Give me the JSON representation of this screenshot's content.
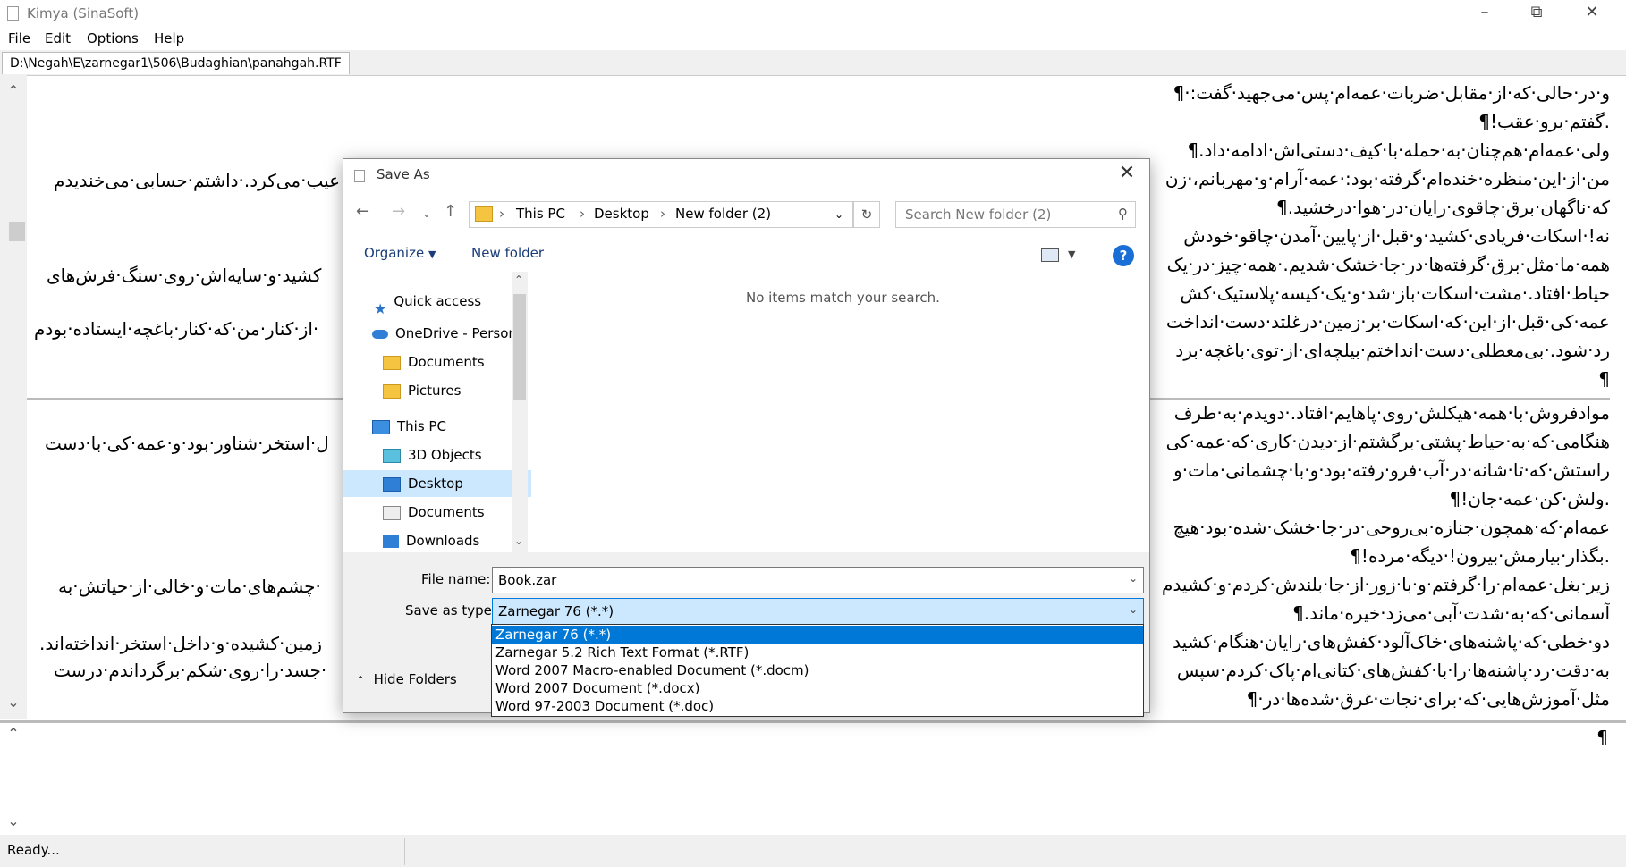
{
  "window": {
    "title": "Kimya (SinaSoft)"
  },
  "menu": [
    "File",
    "Edit",
    "Options",
    "Help"
  ],
  "tab": {
    "path": "D:\\Negah\\E\\zarnegar1\\506\\Budaghian\\panahgah.RTF"
  },
  "editor": {
    "lines": [
      "و·در·حالی·که·از·مقابل·ضربات·عمه‌ام·پس·می‌جهید·گفت:·¶",
      ".گفتم·برو·عقب!¶",
      "ولی·عمه‌ام·هم‌چنان·به·حمله·با·کیف·دستی‌اش·ادامه·داد.¶",
      "من·از·این·منظره·خنده‌ام·گرفته·بود:·عمه·آرام·و·مهربانم،·زن",
      "که·ناگهان·برق·چاقوی·رایان·در·هوا·درخشید.¶",
      "نه!·اسکات·فریادی·کشید·و·قبل·از·پایین·آمدن·چاقو·خودش",
      "همه·ما·مثل·برق·گرفته‌ها·در·جا·خشک·شدیم.·همه·چیز·در·یک",
      "حیاط·افتاد.·مشت·اسکات·باز·شد·و·یک·کیسه·پلاستیک·کش",
      "عمه·کی·قبل·از·این·که·اسکات·بر·زمین·درغلتد·دست·انداخت",
      "رد·شود.·بی‌معطلی·دست·انداختم·بیلچه‌ای·از·توی·باغچه·برد",
      "¶",
      "موادفروش·با·همه·هیکلش·روی·پاهایم·افتاد.·دویدم·به·طرف",
      "هنگامی·که·به·حیاط·پشتی·برگشتم·از·دیدن·کاری·که·عمه·کی",
      "راستش·که·تا·شانه·در·آب·فرو·رفته·بود·و·با·چشمانی·مات·و",
      ".ولش·کن·عمه·جان!¶",
      "عمه‌ام·که·همچون·جنازه·بی‌روحی·در·جا·خشک·شده·بود·هیچ",
      ".بگذار·بیارمش·بیرون!·دیگه·مرده!¶",
      "زیر·بغل·عمه‌ام·را·گرفتم·و·با·زور·از·جا·بلندش·کردم·و·کشیدم",
      "آسمانی·که·به·شدت·آبی·می‌زد·خیره·ماند.¶",
      "دو·خطی·که·پاشنه‌های·خاک‌آلود·کفش‌های·رایان·هنگام·کشید",
      "به·دقت·رد·پاشنه‌ها·را·با·کفش‌های·کتانی‌ام·پاک·کردم·سپس",
      "مثل·آموزش‌هایی·که·برای·نجات·غرق·شده‌ها·در·¶"
    ],
    "left_fragments": [
      "عیب·می‌کرد.·داشتم·حسابی·می‌خندیدم",
      "کشید·و·سایه‌اش·روی·سنگ·فرش‌های",
      "·از·کنار·من·که·کنار·باغچه·ایستاده·بودم",
      "ل·استخر·شناور·بود·و·عمه·کی·با·دست",
      "·چشم‌های·مات·و·خالی·از·حیاتش·به",
      "زمین·کشیده·و·داخل·استخر·انداخته‌اند.",
      "·جسد·را·روی·شکم·برگرداندم·درست"
    ],
    "lower_pane": "¶"
  },
  "status": {
    "text": "Ready..."
  },
  "dialog": {
    "title": "Save As",
    "breadcrumbs": [
      "This PC",
      "Desktop",
      "New folder (2)"
    ],
    "search_placeholder": "Search New folder (2)",
    "organize": "Organize",
    "new_folder": "New folder",
    "nav_items": [
      "Quick access",
      "OneDrive - Person",
      "Documents",
      "Pictures",
      "This PC",
      "3D Objects",
      "Desktop",
      "Documents",
      "Downloads"
    ],
    "empty_message": "No items match your search.",
    "file_name_label": "File name:",
    "file_name_value": "Book.zar",
    "save_type_label": "Save as type:",
    "save_type_value": "Zarnegar 76 (*.*)",
    "hide_folders": "Hide Folders",
    "type_options": [
      "Zarnegar 76 (*.*)",
      "Zarnegar 5.2 Rich Text Format (*.RTF)",
      "Word 2007 Macro-enabled Document (*.docm)",
      "Word 2007 Document (*.docx)",
      "Word 97-2003 Document (*.doc)"
    ]
  },
  "colors": {
    "accent": "#0078d7",
    "folder": "#f5c542",
    "selection": "#cce8ff"
  }
}
